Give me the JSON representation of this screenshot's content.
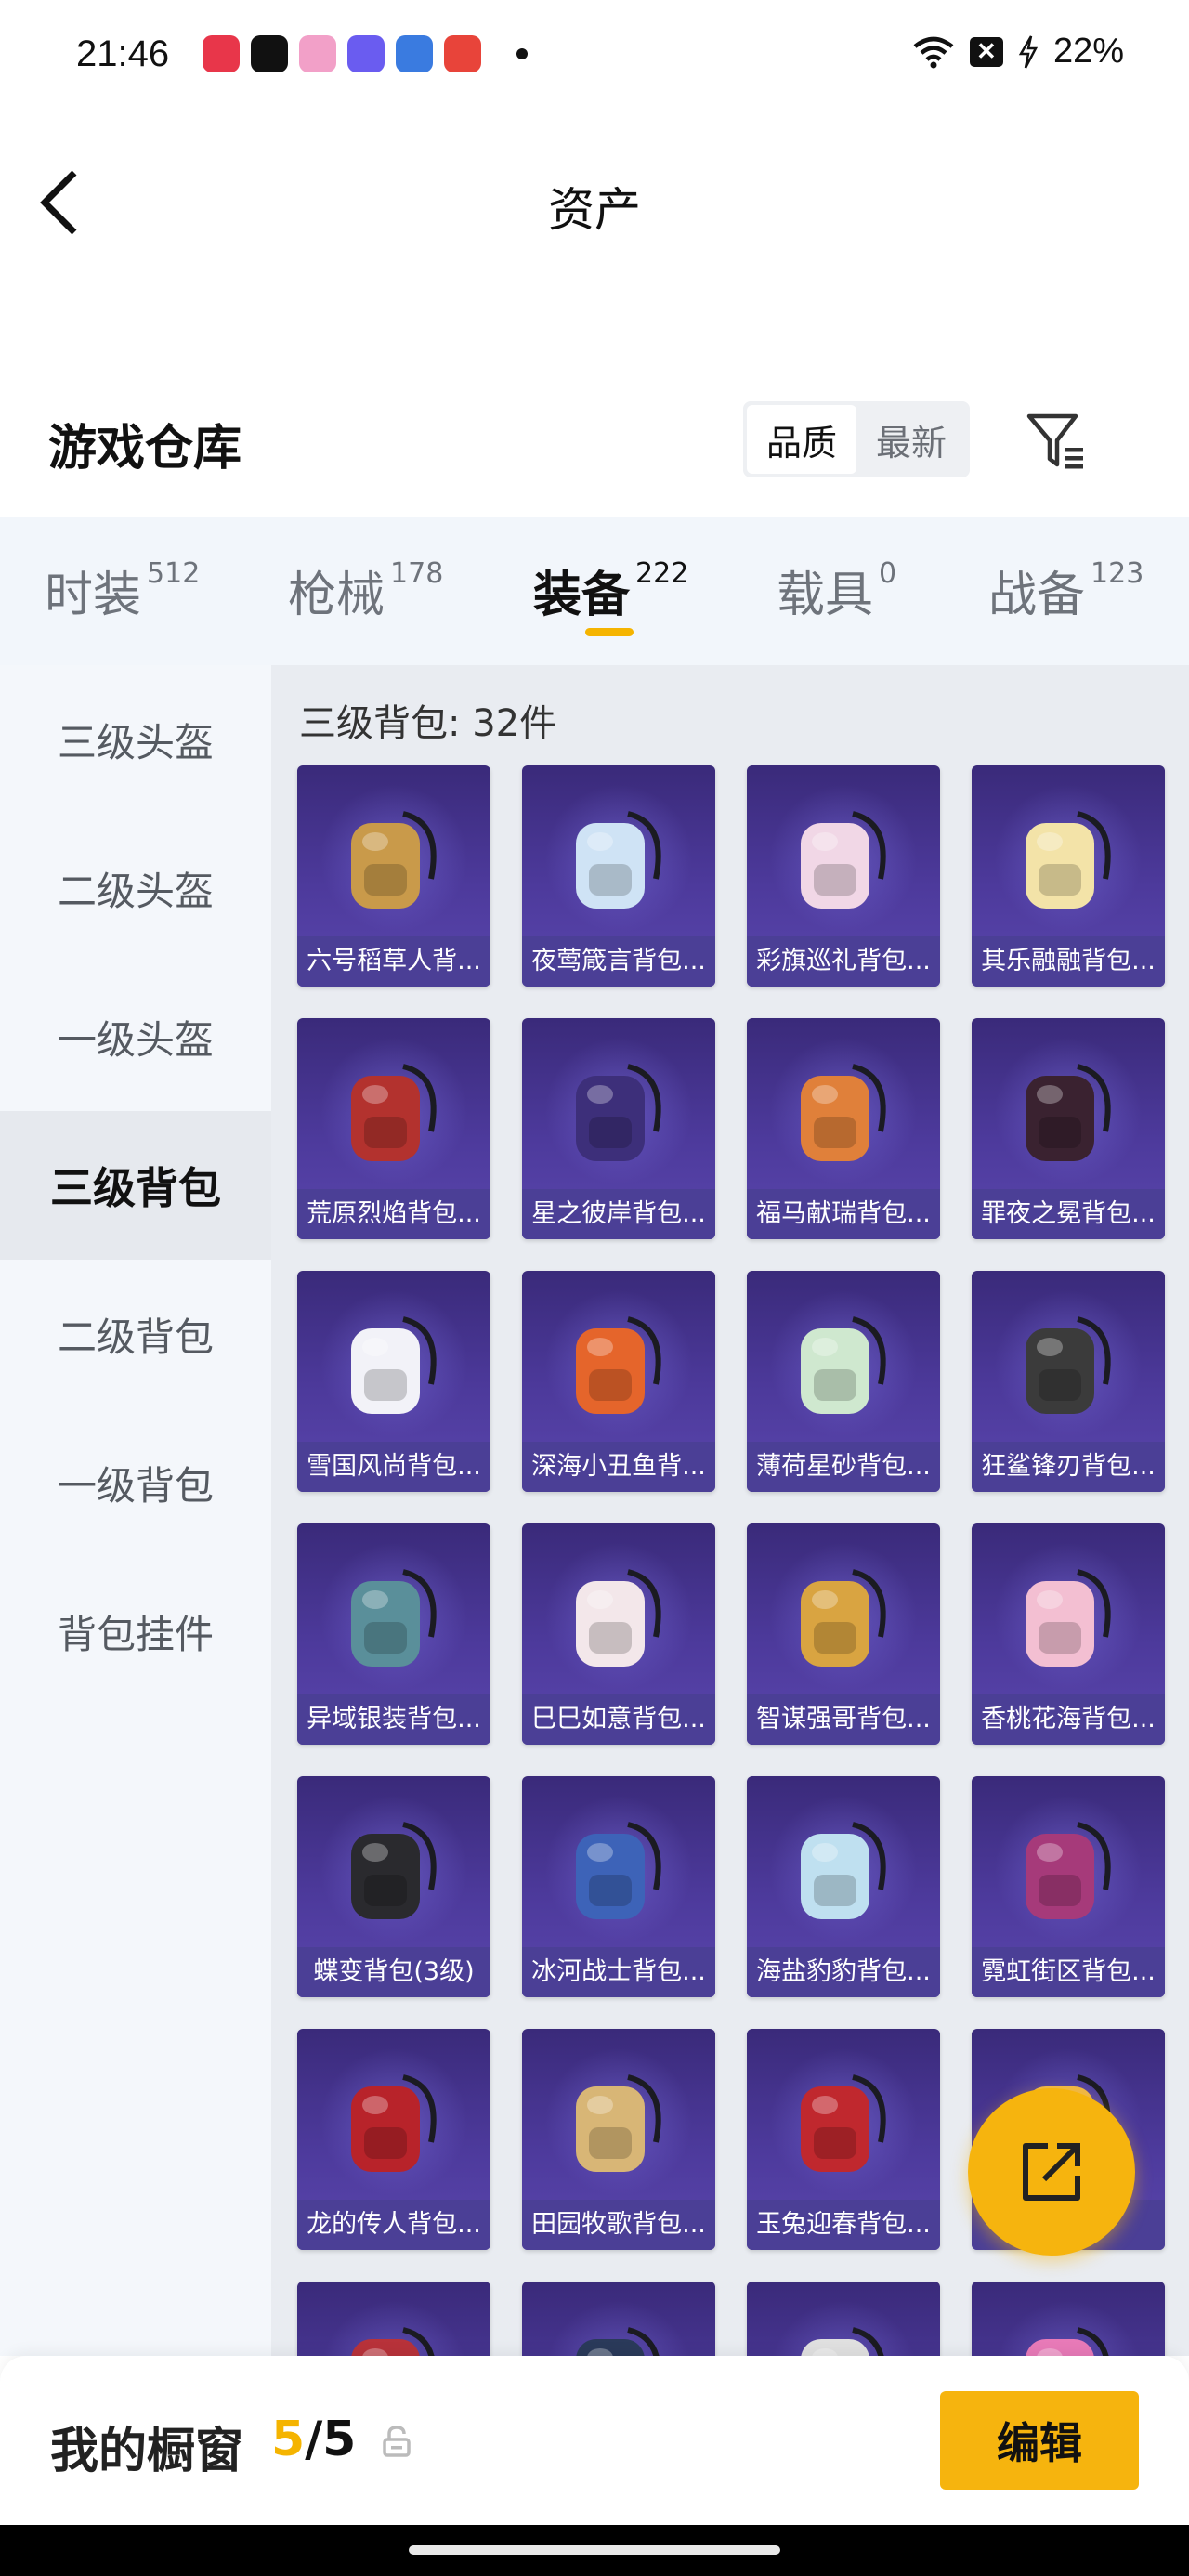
{
  "status_bar": {
    "time": "21:46",
    "battery": "22%",
    "apps": [
      {
        "icon": "music-app-icon",
        "color": "#e8364a"
      },
      {
        "icon": "wechat-icon",
        "color": "#111111"
      },
      {
        "icon": "flower-app-icon",
        "color": "#f2a0c8"
      },
      {
        "icon": "star-app-icon",
        "color": "#6a5cf0"
      },
      {
        "icon": "game-app-icon",
        "color": "#3a7be0"
      },
      {
        "icon": "video-app-icon",
        "color": "#e8443a"
      }
    ]
  },
  "header": {
    "title": "资产",
    "back_icon": "chevron-left-icon"
  },
  "section": {
    "title": "游戏仓库",
    "sort_options": [
      "品质",
      "最新"
    ],
    "sort_selected": "品质",
    "filter_icon": "filter-icon"
  },
  "category_tabs": [
    {
      "label": "时装",
      "count": "512"
    },
    {
      "label": "枪械",
      "count": "178"
    },
    {
      "label": "装备",
      "count": "222",
      "active": true
    },
    {
      "label": "载具",
      "count": "0"
    },
    {
      "label": "战备",
      "count": "123"
    }
  ],
  "sidebar": [
    {
      "label": "三级头盔"
    },
    {
      "label": "二级头盔"
    },
    {
      "label": "一级头盔"
    },
    {
      "label": "三级背包",
      "active": true
    },
    {
      "label": "二级背包"
    },
    {
      "label": "一级背包"
    },
    {
      "label": "背包挂件"
    }
  ],
  "grid": {
    "title": "三级背包: 32件",
    "items": [
      {
        "name": "六号稻草人背...",
        "color": "#c99a4a"
      },
      {
        "name": "夜莺箴言背包...",
        "color": "#cfe3f5"
      },
      {
        "name": "彩旗巡礼背包...",
        "color": "#f1d7e6"
      },
      {
        "name": "其乐融融背包...",
        "color": "#f3e3a8"
      },
      {
        "name": "荒原烈焰背包...",
        "color": "#b3322e"
      },
      {
        "name": "星之彼岸背包...",
        "color": "#3d2f7a"
      },
      {
        "name": "福马献瑞背包...",
        "color": "#e0803a"
      },
      {
        "name": "罪夜之冕背包...",
        "color": "#3a2230"
      },
      {
        "name": "雪国风尚背包...",
        "color": "#f2f2f8"
      },
      {
        "name": "深海小丑鱼背...",
        "color": "#e5652b"
      },
      {
        "name": "薄荷星砂背包...",
        "color": "#cfe8cf"
      },
      {
        "name": "狂鲨锋刃背包...",
        "color": "#3b3b3b"
      },
      {
        "name": "异域银装背包...",
        "color": "#5a8f9a"
      },
      {
        "name": "巳巳如意背包...",
        "color": "#f3e7ea"
      },
      {
        "name": "智谋强哥背包...",
        "color": "#d9a441"
      },
      {
        "name": "香桃花海背包...",
        "color": "#f3bfd2"
      },
      {
        "name": "蝶变背包(3级)",
        "color": "#2a2a2e"
      },
      {
        "name": "冰河战士背包...",
        "color": "#3d63b8"
      },
      {
        "name": "海盐豹豹背包...",
        "color": "#bfe0f0"
      },
      {
        "name": "霓虹街区背包...",
        "color": "#a63a7a"
      },
      {
        "name": "龙的传人背包...",
        "color": "#b8232a"
      },
      {
        "name": "田园牧歌背包...",
        "color": "#d8b676"
      },
      {
        "name": "玉兔迎春背包...",
        "color": "#c0282e"
      },
      {
        "name": "...",
        "color": "#f0b848"
      },
      {
        "name": "",
        "color": "#b8323a"
      },
      {
        "name": "",
        "color": "#2a3a5a"
      },
      {
        "name": "",
        "color": "#e0e0e0"
      },
      {
        "name": "",
        "color": "#e87ab8"
      }
    ]
  },
  "fab": {
    "icon": "share-edit-icon"
  },
  "bottom_bar": {
    "label": "我的橱窗",
    "count_current": "5",
    "count_total": "/5",
    "lock_icon": "lock-icon",
    "edit_label": "编辑"
  }
}
